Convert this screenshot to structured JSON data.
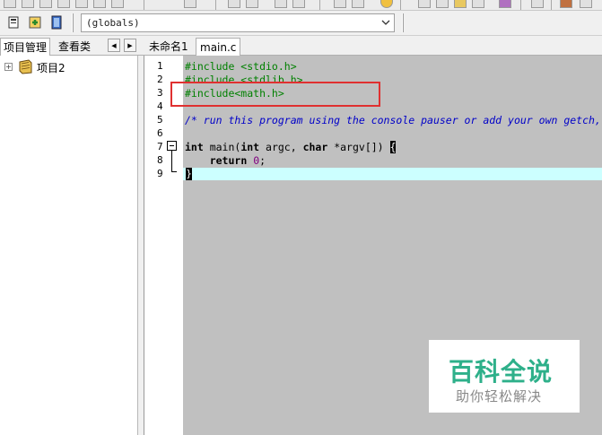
{
  "scope_dropdown": {
    "value": "(globals)"
  },
  "left_panel": {
    "tabs": [
      "项目管理",
      "查看类"
    ],
    "tree": [
      {
        "label": "项目2",
        "expander": "+"
      }
    ]
  },
  "editor": {
    "tabs": [
      "未命名1",
      "main.c"
    ],
    "line_numbers": [
      "1",
      "2",
      "3",
      "4",
      "5",
      "6",
      "7",
      "8",
      "9"
    ],
    "lines": {
      "l1": "#include <stdio.h>",
      "l2": "#include <stdlib.h>",
      "l3": "#include<math.h>",
      "l5": "/* run this program using the console pauser or add your own getch,",
      "l7_kw1": "int",
      "l7_mid1": " main(",
      "l7_kw2": "int",
      "l7_mid2": " argc, ",
      "l7_kw3": "char",
      "l7_mid3": " *argv[]) ",
      "l7_brace": "{",
      "l8_kw": "return",
      "l8_num": "0",
      "l8_end": ";",
      "l9_brace": "}"
    }
  },
  "watermark": {
    "main": "百科全说",
    "sub": "助你轻松解决"
  },
  "colors": {
    "preprocessor": "#008000",
    "comment": "#0000c8",
    "number": "#800080",
    "active_line": "#ccffff",
    "annotation": "#e03030",
    "watermark": "#2eb08a"
  }
}
